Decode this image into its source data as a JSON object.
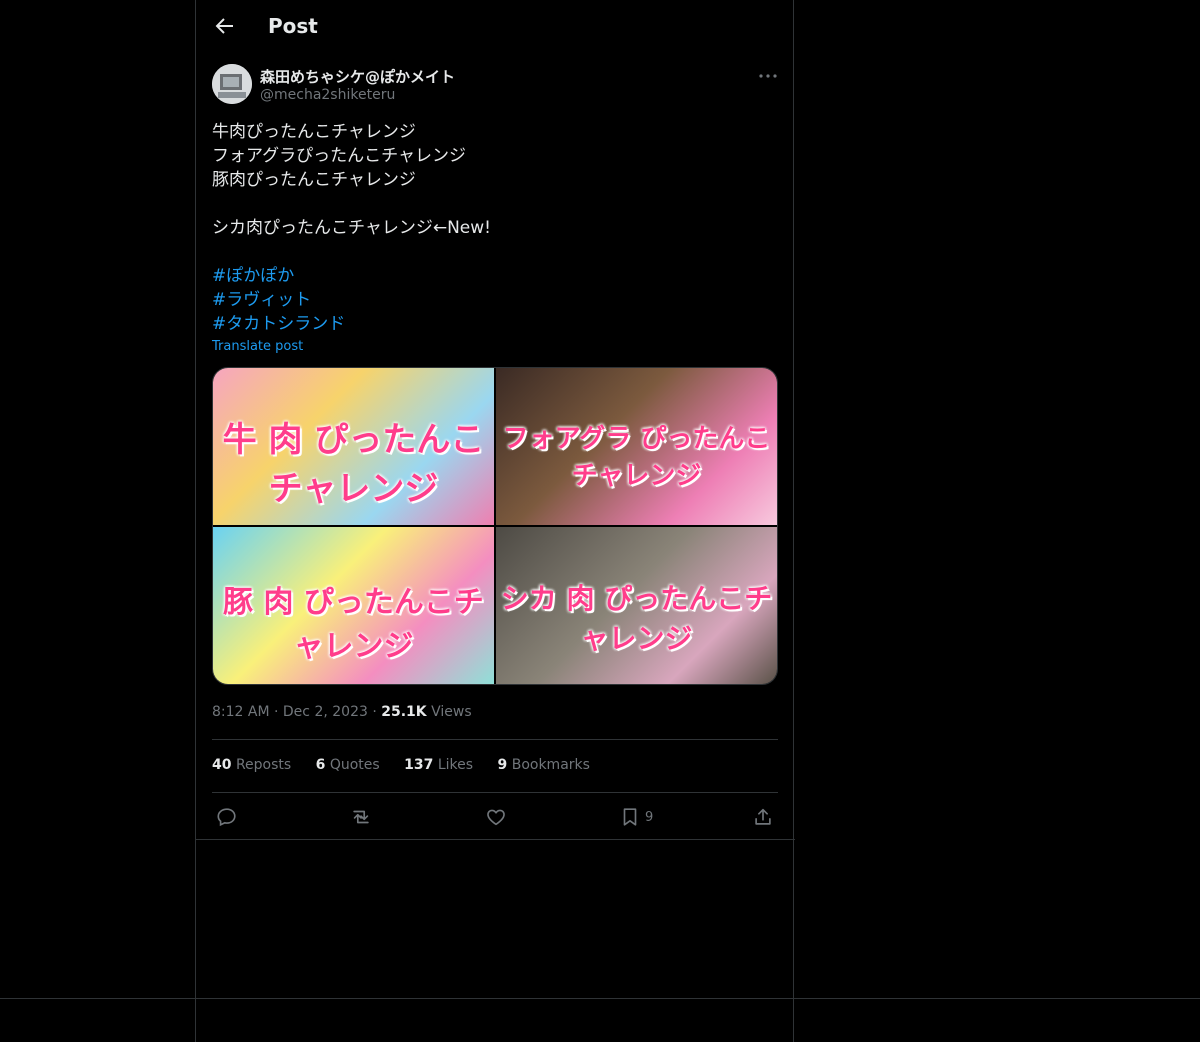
{
  "header": {
    "title": "Post"
  },
  "author": {
    "name": "森田めちゃシケ@ぽかメイト",
    "handle": "@mecha2shiketeru"
  },
  "post": {
    "lines": [
      "牛肉ぴったんこチャレンジ",
      "フォアグラぴったんこチャレンジ",
      "豚肉ぴったんこチャレンジ",
      "",
      "シカ肉ぴったんこチャレンジ←New!",
      ""
    ],
    "hashtags": [
      "#ぽかぽか",
      "#ラヴィット",
      "#タカトシランド"
    ],
    "translate": "Translate post"
  },
  "media": [
    {
      "caption": "牛 肉 ぴったんこチャレンジ"
    },
    {
      "caption": "フォアグラ ぴったんこチャレンジ"
    },
    {
      "caption": "豚 肉 ぴったんこチャレンジ"
    },
    {
      "caption": "シカ 肉 ぴったんこチャレンジ"
    }
  ],
  "meta": {
    "time": "8:12 AM",
    "date": "Dec 2, 2023",
    "views_count": "25.1K",
    "views_label": "Views"
  },
  "stats": {
    "reposts_count": "40",
    "reposts_label": "Reposts",
    "quotes_count": "6",
    "quotes_label": "Quotes",
    "likes_count": "137",
    "likes_label": "Likes",
    "bookmarks_count": "9",
    "bookmarks_label": "Bookmarks"
  },
  "actions": {
    "bookmark_count": "9"
  },
  "icons": [
    "back-arrow-icon",
    "more-icon",
    "reply-icon",
    "repost-icon",
    "like-icon",
    "bookmark-icon",
    "share-icon"
  ],
  "colors": {
    "background": "#000000",
    "text": "#e7e9ea",
    "muted": "#71767b",
    "accent": "#1d9bf0",
    "border": "#2f3336"
  }
}
